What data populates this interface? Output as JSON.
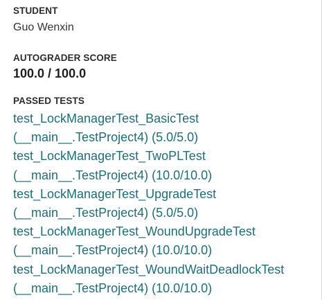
{
  "student": {
    "label": "STUDENT",
    "name": "Guo Wenxin"
  },
  "score": {
    "label": "AUTOGRADER SCORE",
    "value": "100.0 / 100.0"
  },
  "passed": {
    "label": "PASSED TESTS",
    "tests": [
      {
        "name": "test_LockManagerTest_BasicTest",
        "detail": "(__main__.TestProject4) (5.0/5.0)"
      },
      {
        "name": "test_LockManagerTest_TwoPLTest",
        "detail": "(__main__.TestProject4) (10.0/10.0)"
      },
      {
        "name": "test_LockManagerTest_UpgradeTest",
        "detail": "(__main__.TestProject4) (5.0/5.0)"
      },
      {
        "name": "test_LockManagerTest_WoundUpgradeTest",
        "detail": "(__main__.TestProject4) (10.0/10.0)"
      },
      {
        "name": "test_LockManagerTest_WoundWaitDeadlockTest",
        "detail": "(__main__.TestProject4) (10.0/10.0)"
      }
    ]
  },
  "colors": {
    "link": "#1d6d7a",
    "label": "#2b2b2b",
    "text": "#333333"
  }
}
